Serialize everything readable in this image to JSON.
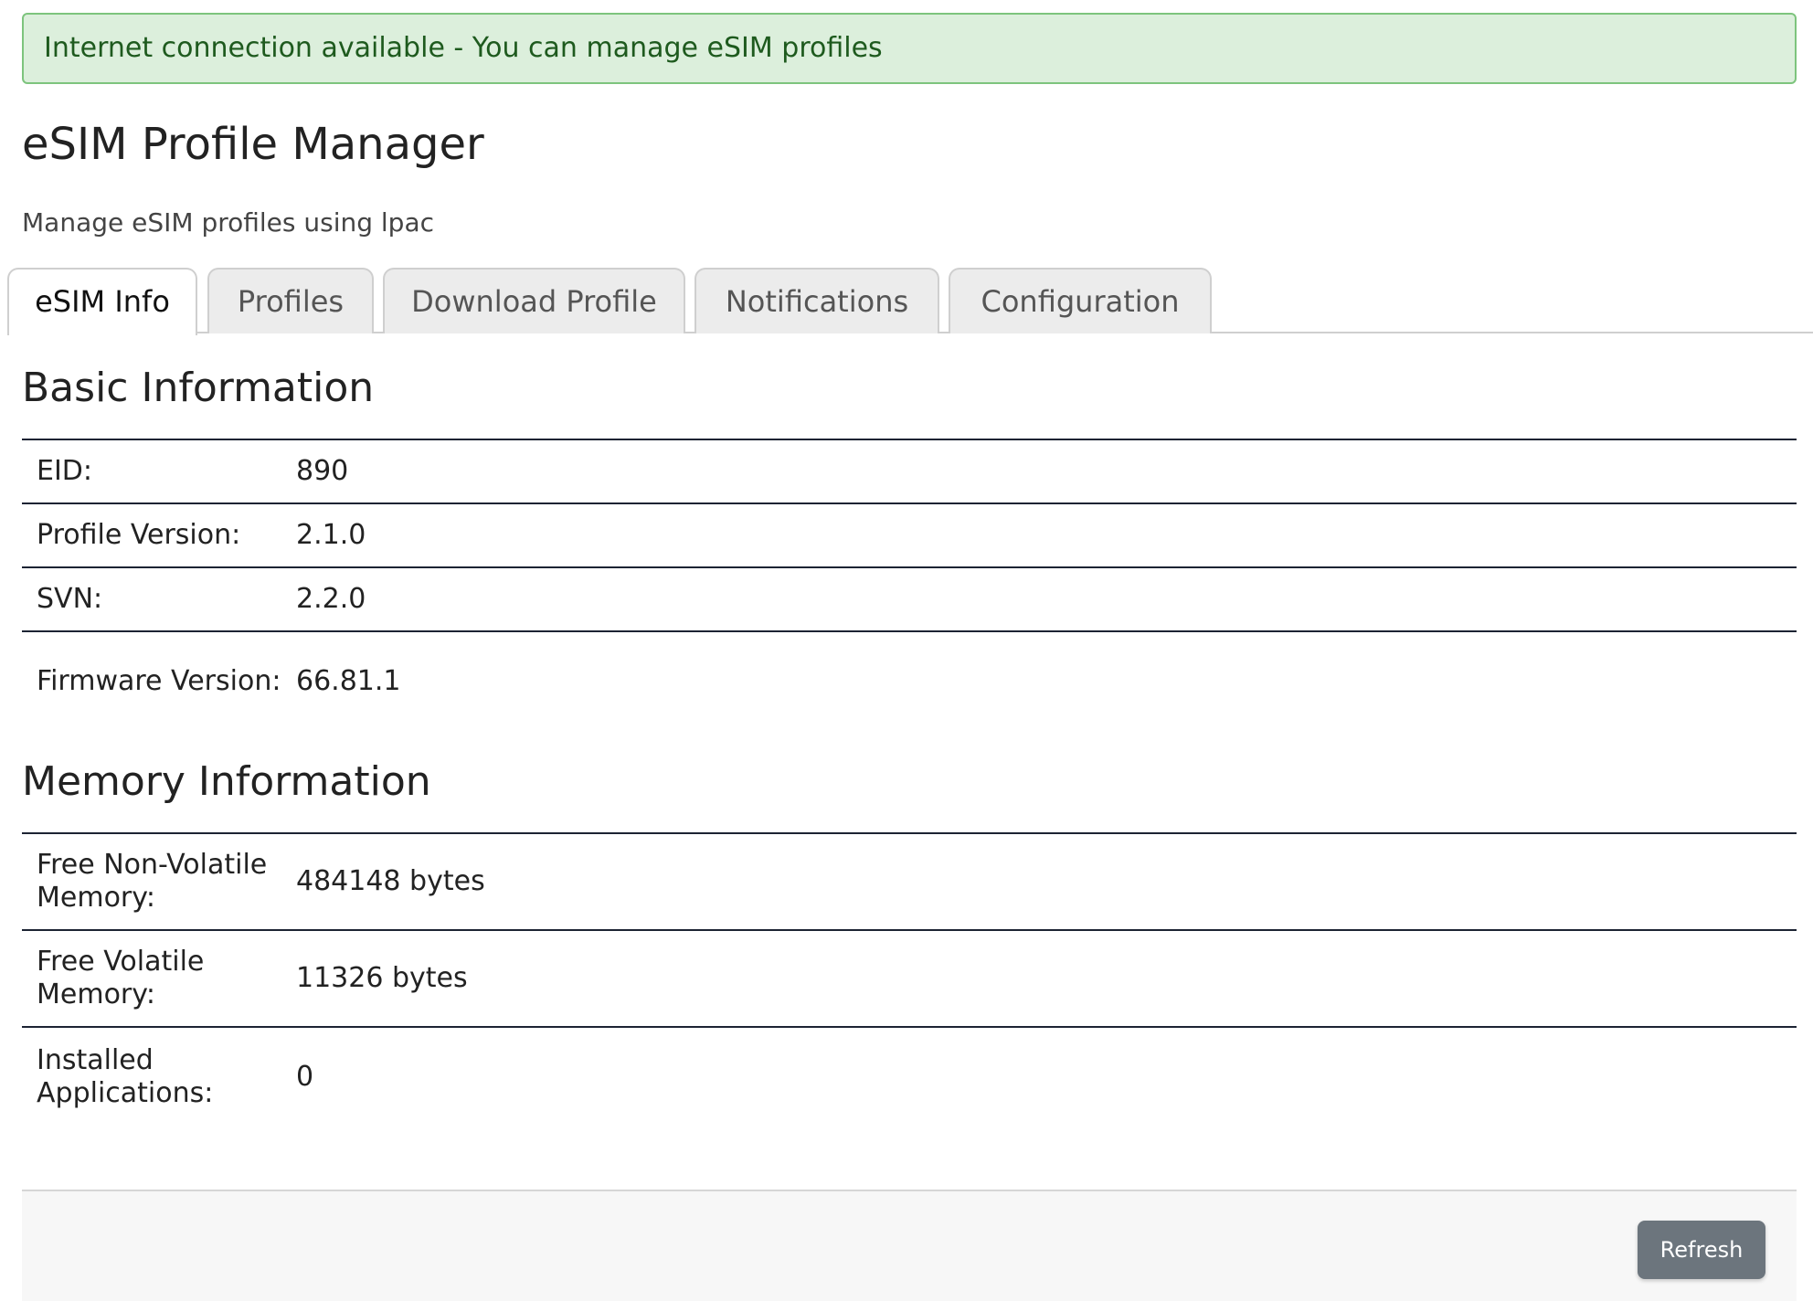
{
  "alert": {
    "text": "Internet connection available - You can manage eSIM profiles",
    "color": "#dcefdc",
    "border_color": "#7dc47d"
  },
  "header": {
    "title": "eSIM Profile Manager",
    "subtitle": "Manage eSIM profiles using lpac"
  },
  "tabs": [
    {
      "label": "eSIM Info",
      "active": true
    },
    {
      "label": "Profiles",
      "active": false
    },
    {
      "label": "Download Profile",
      "active": false
    },
    {
      "label": "Notifications",
      "active": false
    },
    {
      "label": "Configuration",
      "active": false
    }
  ],
  "basic_info": {
    "title": "Basic Information",
    "rows": [
      {
        "label": "EID:",
        "value": "890"
      },
      {
        "label": "Profile Version:",
        "value": "2.1.0"
      },
      {
        "label": "SVN:",
        "value": "2.2.0"
      },
      {
        "label": "Firmware Version:",
        "value": "66.81.1"
      }
    ]
  },
  "memory_info": {
    "title": "Memory Information",
    "rows": [
      {
        "label": "Free Non-Volatile Memory:",
        "value": "484148 bytes"
      },
      {
        "label": "Free Volatile Memory:",
        "value": "11326 bytes"
      },
      {
        "label": "Installed Applications:",
        "value": "0"
      }
    ]
  },
  "footer": {
    "refresh_label": "Refresh",
    "button_color": "#6c757d"
  }
}
